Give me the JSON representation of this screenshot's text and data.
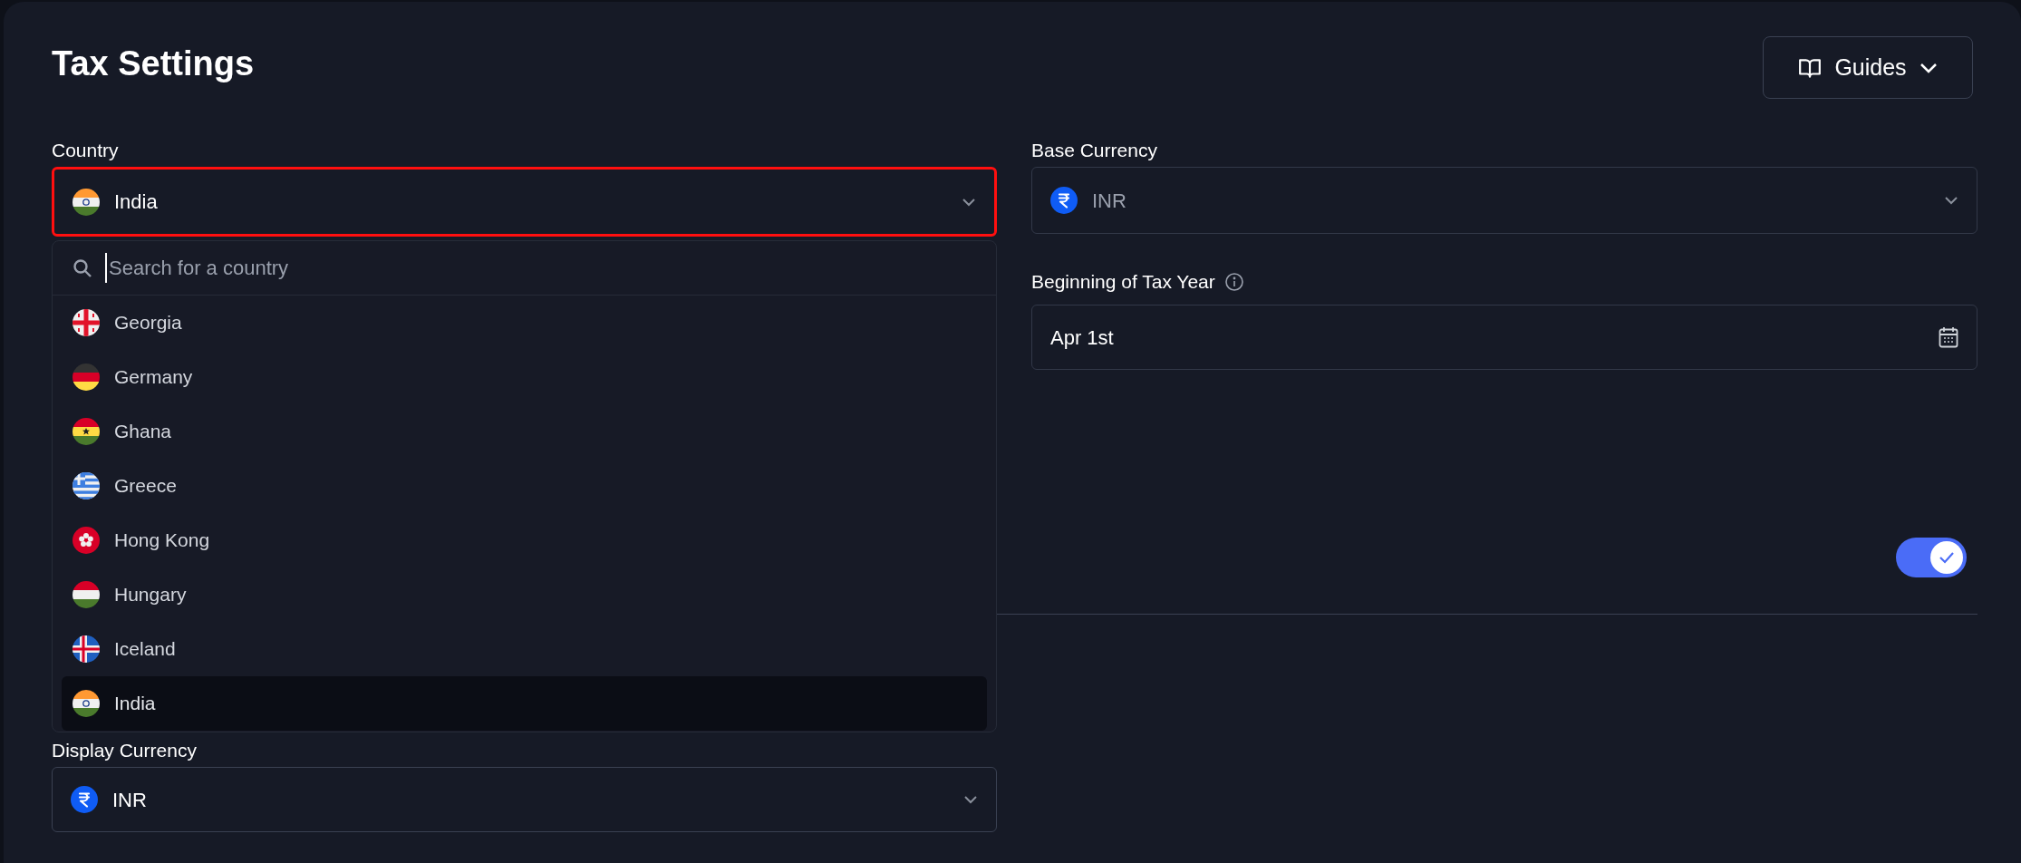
{
  "header": {
    "title": "Tax Settings",
    "guides_button": "Guides"
  },
  "country": {
    "label": "Country",
    "value": "India",
    "kind": "in",
    "highlighted": true
  },
  "country_dropdown": {
    "search_placeholder": "Search for a country",
    "options": [
      {
        "name": "Georgia",
        "kind": "ge",
        "selected": false
      },
      {
        "name": "Germany",
        "kind": "de",
        "selected": false
      },
      {
        "name": "Ghana",
        "kind": "gh",
        "selected": false
      },
      {
        "name": "Greece",
        "kind": "gr",
        "selected": false
      },
      {
        "name": "Hong Kong",
        "kind": "hk",
        "selected": false
      },
      {
        "name": "Hungary",
        "kind": "hu",
        "selected": false
      },
      {
        "name": "Iceland",
        "kind": "is",
        "selected": false
      },
      {
        "name": "India",
        "kind": "in",
        "selected": true
      }
    ]
  },
  "base_currency": {
    "label": "Base Currency",
    "value": "INR",
    "disabled": true
  },
  "tax_year": {
    "label": "Beginning of Tax Year",
    "value": "Apr 1st"
  },
  "toggle": {
    "on": true
  },
  "display_currency": {
    "label": "Display Currency",
    "value": "INR"
  }
}
